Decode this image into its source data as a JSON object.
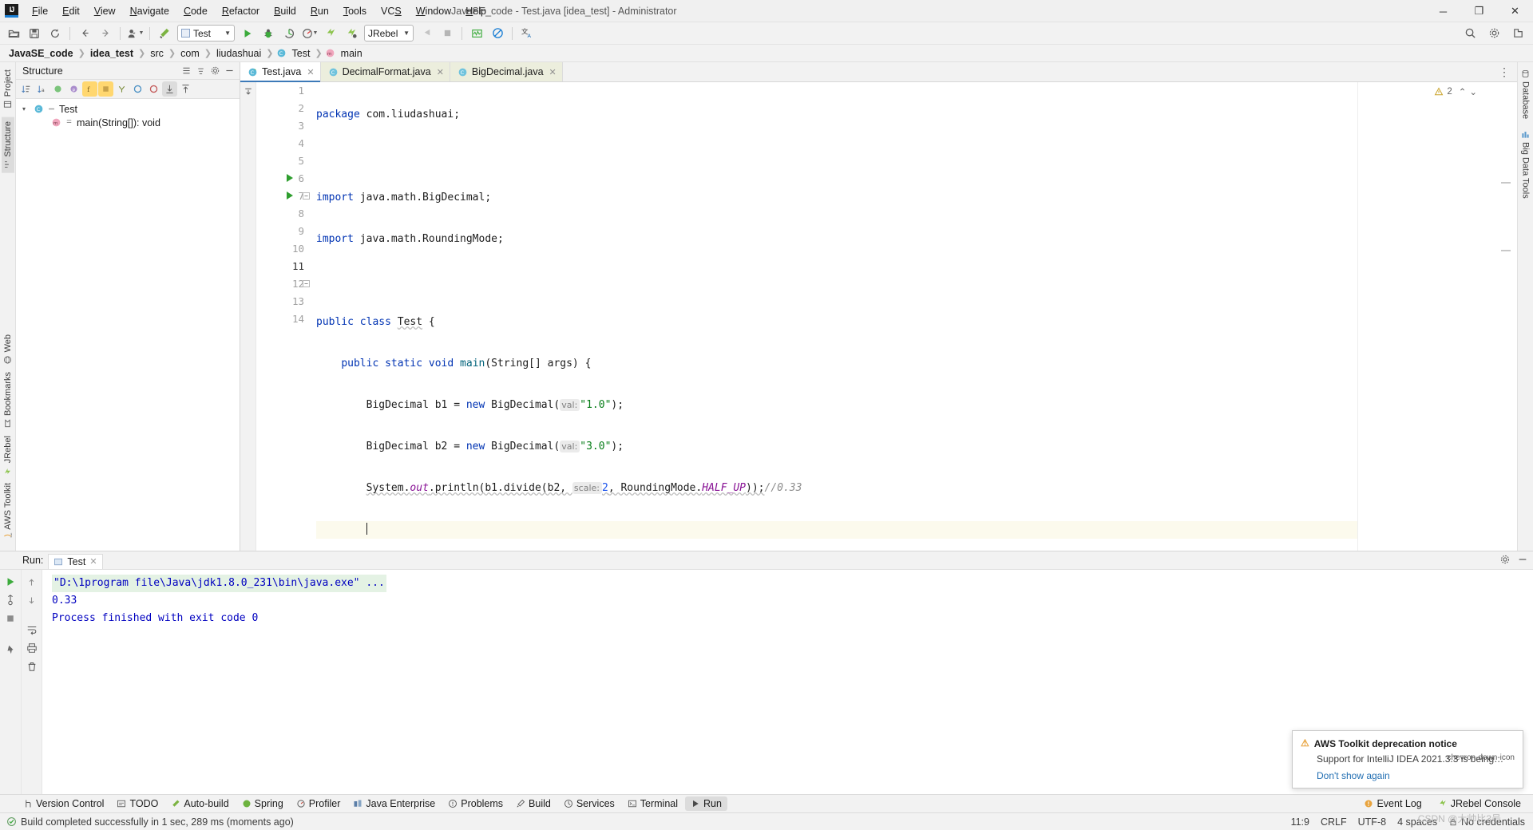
{
  "window": {
    "title": "JavaSE_code - Test.java [idea_test] - Administrator",
    "logo": "IJ",
    "minimize": "─",
    "maximize": "❐",
    "close": "✕"
  },
  "menu": [
    {
      "label": "File"
    },
    {
      "label": "Edit"
    },
    {
      "label": "View"
    },
    {
      "label": "Navigate"
    },
    {
      "label": "Code"
    },
    {
      "label": "Refactor"
    },
    {
      "label": "Build"
    },
    {
      "label": "Run"
    },
    {
      "label": "Tools"
    },
    {
      "label": "VCS"
    },
    {
      "label": "Window"
    },
    {
      "label": "Help"
    }
  ],
  "toolbar": {
    "open_icon": "open-folder-icon",
    "save_icon": "save-icon",
    "sync_icon": "refresh-icon",
    "back_icon": "arrow-left-icon",
    "forward_icon": "arrow-right-icon",
    "profile_icon": "user-profile-icon",
    "build_icon": "hammer-icon",
    "run_config": "Test",
    "run_icon": "run-play-icon",
    "debug_icon": "debug-bug-icon",
    "coverage_icon": "run-with-coverage-icon",
    "profiler_icon": "profiler-icon",
    "jrebel_run_icon": "jrebel-run-icon",
    "jrebel_debug_icon": "jrebel-debug-icon",
    "jrebel_config": "JRebel",
    "stop_icon": "stop-icon",
    "attach_icon": "attach-icon",
    "chart_icon": "jrebel-monitor-icon",
    "disable_icon": "jrebel-disable-icon",
    "translate_icon": "translate-icon",
    "search_icon": "search-everywhere-icon",
    "settings_icon": "gear-icon",
    "plugin_icon": "plugin-icon"
  },
  "breadcrumb": [
    {
      "label": "JavaSE_code",
      "bold": true
    },
    {
      "label": "idea_test",
      "bold": true
    },
    {
      "label": "src",
      "bold": false
    },
    {
      "label": "com",
      "bold": false
    },
    {
      "label": "liudashuai",
      "bold": false
    },
    {
      "label": "Test",
      "bold": false,
      "icon": "class-icon"
    },
    {
      "label": "main",
      "bold": false,
      "icon": "method-icon"
    }
  ],
  "left_strip": [
    {
      "label": "Project",
      "icon": "project-icon"
    },
    {
      "label": "Structure",
      "icon": "structure-icon"
    }
  ],
  "left_strip_bottom": [
    {
      "label": "Web",
      "icon": "web-icon"
    },
    {
      "label": "Bookmarks",
      "icon": "bookmark-icon"
    },
    {
      "label": "JRebel",
      "icon": "jrebel-icon"
    },
    {
      "label": "AWS Toolkit",
      "icon": "aws-icon"
    }
  ],
  "right_strip": [
    {
      "label": "Database",
      "icon": "database-icon"
    },
    {
      "label": "Big Data Tools",
      "icon": "bigdata-icon"
    }
  ],
  "structure": {
    "title": "Structure",
    "header_buttons": [
      "expand-all-icon",
      "collapse-all-icon",
      "gear-icon",
      "hide-icon"
    ],
    "toolbar_icons": [
      "sort-by-type-icon",
      "sort-alphabetically-icon",
      "show-inherited-icon",
      "show-properties-icon",
      "show-fields-icon",
      "show-non-public-icon",
      "show-anonymous-icon",
      "show-public-icon",
      "show-private-icon",
      "autoscroll-to-source-icon",
      "autoscroll-from-source-icon"
    ],
    "tree": [
      {
        "label": "Test",
        "icon": "class-icon",
        "expanded": true,
        "arrow": "▾",
        "indent": 0
      },
      {
        "label": "main(String[]): void",
        "icon": "method-icon",
        "indent": 1
      }
    ]
  },
  "tabs": [
    {
      "label": "Test.java",
      "icon": "java-class-icon",
      "active": true
    },
    {
      "label": "DecimalFormat.java",
      "icon": "java-readonly-icon",
      "active": false
    },
    {
      "label": "BigDecimal.java",
      "icon": "java-readonly-icon",
      "active": false
    }
  ],
  "editor": {
    "lines": [
      {
        "n": 1
      },
      {
        "n": 2
      },
      {
        "n": 3
      },
      {
        "n": 4
      },
      {
        "n": 5
      },
      {
        "n": 6
      },
      {
        "n": 7
      },
      {
        "n": 8
      },
      {
        "n": 9
      },
      {
        "n": 10
      },
      {
        "n": 11,
        "current": true
      },
      {
        "n": 12
      },
      {
        "n": 13
      },
      {
        "n": 14
      }
    ],
    "code": {
      "l1_kw": "package",
      "l1_rest": " com.liudashuai;",
      "l3_kw": "import",
      "l3_rest": " java.math.BigDecimal;",
      "l4_kw": "import",
      "l4_rest": " java.math.RoundingMode;",
      "l6_kw1": "public",
      "l6_kw2": "class",
      "l6_name": "Test",
      "l6_brace": "{",
      "l7_kw1": "public",
      "l7_kw2": "static",
      "l7_kw3": "void",
      "l7_name": "main",
      "l7_args": "(String[] args) {",
      "l8_type": "BigDecimal b1 = ",
      "l8_new": "new",
      "l8_ctor": " BigDecimal(",
      "l8_hint": "val:",
      "l8_val": "\"1.0\"",
      "l8_end": ");",
      "l9_type": "BigDecimal b2 = ",
      "l9_new": "new",
      "l9_ctor": " BigDecimal(",
      "l9_hint": "val:",
      "l9_val": "\"3.0\"",
      "l9_end": ");",
      "l10_a": "System.",
      "l10_out": "out",
      "l10_b": ".println(b1.divide(b2, ",
      "l10_hint": "scale:",
      "l10_num": "2",
      "l10_c": ", RoundingMode.",
      "l10_const": "HALF_UP",
      "l10_d": "));",
      "l10_comment": "//0.33",
      "l12_brace": "}",
      "l13_brace": "}"
    },
    "inspection_count": "2",
    "inspection_icon": "warning-triangle-icon",
    "up_arrow": "⌃",
    "down_arrow": "⌄"
  },
  "run_panel": {
    "label": "Run:",
    "tab_label": "Test",
    "tab_icon": "run-config-icon",
    "gutter_buttons": [
      "rerun-icon",
      "rerun-failed-icon",
      "stop-icon",
      "pin-icon"
    ],
    "gutter2_buttons": [
      "scroll-up-icon",
      "scroll-down-icon",
      "soft-wrap-icon",
      "print-icon",
      "clear-all-icon"
    ],
    "settings_icon": "gear-icon",
    "hide_icon": "hide-icon",
    "console": [
      {
        "text": "\"D:\\1program file\\Java\\jdk1.8.0_231\\bin\\java.exe\" ...",
        "highlight": true
      },
      {
        "text": "0.33",
        "highlight": false
      },
      {
        "text": "",
        "highlight": false
      },
      {
        "text": "Process finished with exit code 0",
        "highlight": false
      }
    ]
  },
  "bottom_bar": {
    "items": [
      {
        "label": "Version Control",
        "icon": "vcs-icon"
      },
      {
        "label": "TODO",
        "icon": "todo-icon"
      },
      {
        "label": "Auto-build",
        "icon": "autobuild-icon"
      },
      {
        "label": "Spring",
        "icon": "spring-icon"
      },
      {
        "label": "Profiler",
        "icon": "profiler-icon"
      },
      {
        "label": "Java Enterprise",
        "icon": "java-enterprise-icon"
      },
      {
        "label": "Problems",
        "icon": "problems-icon"
      },
      {
        "label": "Build",
        "icon": "build-icon"
      },
      {
        "label": "Services",
        "icon": "services-icon"
      },
      {
        "label": "Terminal",
        "icon": "terminal-icon"
      },
      {
        "label": "Run",
        "icon": "run-play-icon",
        "active": true
      }
    ],
    "right": [
      {
        "label": "Event Log",
        "icon": "event-log-icon"
      },
      {
        "label": "JRebel Console",
        "icon": "jrebel-icon"
      }
    ]
  },
  "status_bar": {
    "message": "Build completed successfully in 1 sec, 289 ms (moments ago)",
    "position": "11:9",
    "line_sep": "CRLF",
    "encoding": "UTF-8",
    "indent": "4 spaces",
    "vcs": "No credentials",
    "lock_icon": "lock-icon",
    "build_icon": "build-success-icon"
  },
  "notification": {
    "title": "AWS Toolkit deprecation notice",
    "body": "Support for IntelliJ IDEA 2021.3.3 is being…",
    "link": "Don't show again",
    "icon": "warning-triangle-icon",
    "collapse_icon": "chevron-down-icon"
  },
  "watermark": "CSDN @大帅比3号",
  "colors": {
    "accent": "#3d7ab8",
    "keyword": "#0033b3",
    "string": "#067d17",
    "number": "#1750eb",
    "comment": "#8c8c8c",
    "console": "#0000c0",
    "run_green": "#2e9e2e",
    "warn": "#e8a33d"
  }
}
